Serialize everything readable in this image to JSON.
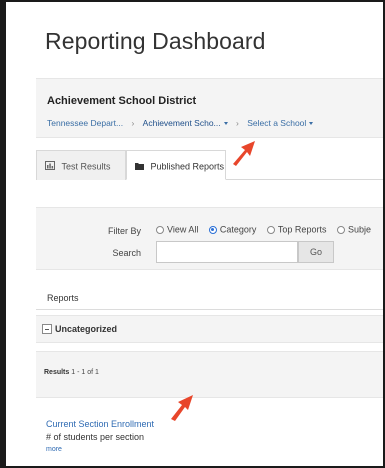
{
  "page": {
    "title": "Reporting Dashboard"
  },
  "district": {
    "name": "Achievement School District",
    "breadcrumb": {
      "root": "Tennessee Depart...",
      "current": "Achievement Scho...",
      "school_select": "Select a School"
    }
  },
  "tabs": [
    {
      "label": "Test Results",
      "icon": "bar-chart-icon",
      "active": false
    },
    {
      "label": "Published Reports",
      "icon": "folder-icon",
      "active": true
    }
  ],
  "filter": {
    "filter_label": "Filter By",
    "options": [
      {
        "label": "View All",
        "checked": false
      },
      {
        "label": "Category",
        "checked": true
      },
      {
        "label": "Top Reports",
        "checked": false
      },
      {
        "label": "Subje",
        "checked": false
      }
    ],
    "search_label": "Search",
    "search_value": "",
    "go_label": "Go"
  },
  "reports": {
    "heading": "Reports",
    "category": "Uncategorized",
    "results_prefix": "Results",
    "results_range": "1 - 1 of 1",
    "items": [
      {
        "title": "Current Section Enrollment",
        "description": "# of students per section",
        "more": "more"
      }
    ]
  },
  "colors": {
    "link": "#2f6bb3",
    "annotation_arrow": "#e8462b",
    "radio_checked": "#2a6fd6"
  }
}
